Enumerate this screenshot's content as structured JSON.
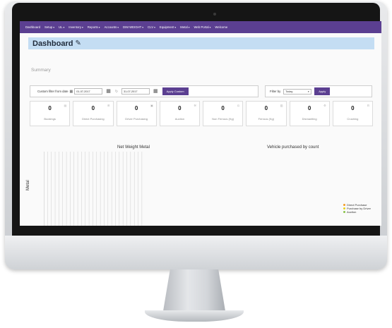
{
  "nav": {
    "items": [
      {
        "label": "Dashboard",
        "caret": ""
      },
      {
        "label": "Setup",
        "caret": "▾"
      },
      {
        "label": "UL",
        "caret": "▾"
      },
      {
        "label": "Inventory",
        "caret": "▾"
      },
      {
        "label": "Reports",
        "caret": "▾"
      },
      {
        "label": "Accounts",
        "caret": "▾"
      },
      {
        "label": "DIM WEIGHT",
        "caret": "▾"
      },
      {
        "label": "CLV",
        "caret": "▾"
      },
      {
        "label": "Equipment",
        "caret": "▾"
      },
      {
        "label": "Metal",
        "caret": "▾"
      },
      {
        "label": "Web Portal",
        "caret": "▾"
      },
      {
        "label": "Welcome",
        "caret": ""
      }
    ]
  },
  "header": {
    "title": "Dashboard",
    "edit_icon": "pencil-icon"
  },
  "summary": {
    "label": "Summary"
  },
  "custom_filter": {
    "label": "Custom filter from date",
    "calendar_icon": "calendar-icon",
    "from_date": "01-07-2017",
    "to_date": "31-07-2017",
    "apply_label": "Apply Custom"
  },
  "filter_by": {
    "label": "Filter by",
    "selected": "Today",
    "apply_label": "Apply"
  },
  "cards": [
    {
      "value": "0",
      "label": "Bookings",
      "icon": "book-icon"
    },
    {
      "value": "0",
      "label": "Direct Purchasing",
      "icon": "cart-icon"
    },
    {
      "value": "0",
      "label": "Driver Purchasing",
      "icon": "truck-icon"
    },
    {
      "value": "0",
      "label": "Auction",
      "icon": "gavel-icon"
    },
    {
      "value": "0",
      "label": "Non Ferrous (Kg)",
      "icon": "scale-icon"
    },
    {
      "value": "0",
      "label": "Ferrous (Kg)",
      "icon": "weight-icon"
    },
    {
      "value": "0",
      "label": "Dismantling",
      "icon": "wrench-icon"
    },
    {
      "value": "0",
      "label": "Crushing",
      "icon": "crusher-icon"
    }
  ],
  "chart_data": [
    {
      "type": "bar",
      "title": "Net Weight Metal",
      "ylabel": "Metal",
      "categories": [],
      "values": [],
      "grid": true,
      "gridlines": 26
    },
    {
      "type": "pie",
      "title": "Vehicle purchased by count",
      "legend_position": "right",
      "series": [
        {
          "name": "Direct Purchase",
          "color": "#f59b23",
          "value": 0
        },
        {
          "name": "Purchase by Driver",
          "color": "#e8d21a",
          "value": 0
        },
        {
          "name": "Auction",
          "color": "#8bc34a",
          "value": 0
        }
      ]
    }
  ]
}
